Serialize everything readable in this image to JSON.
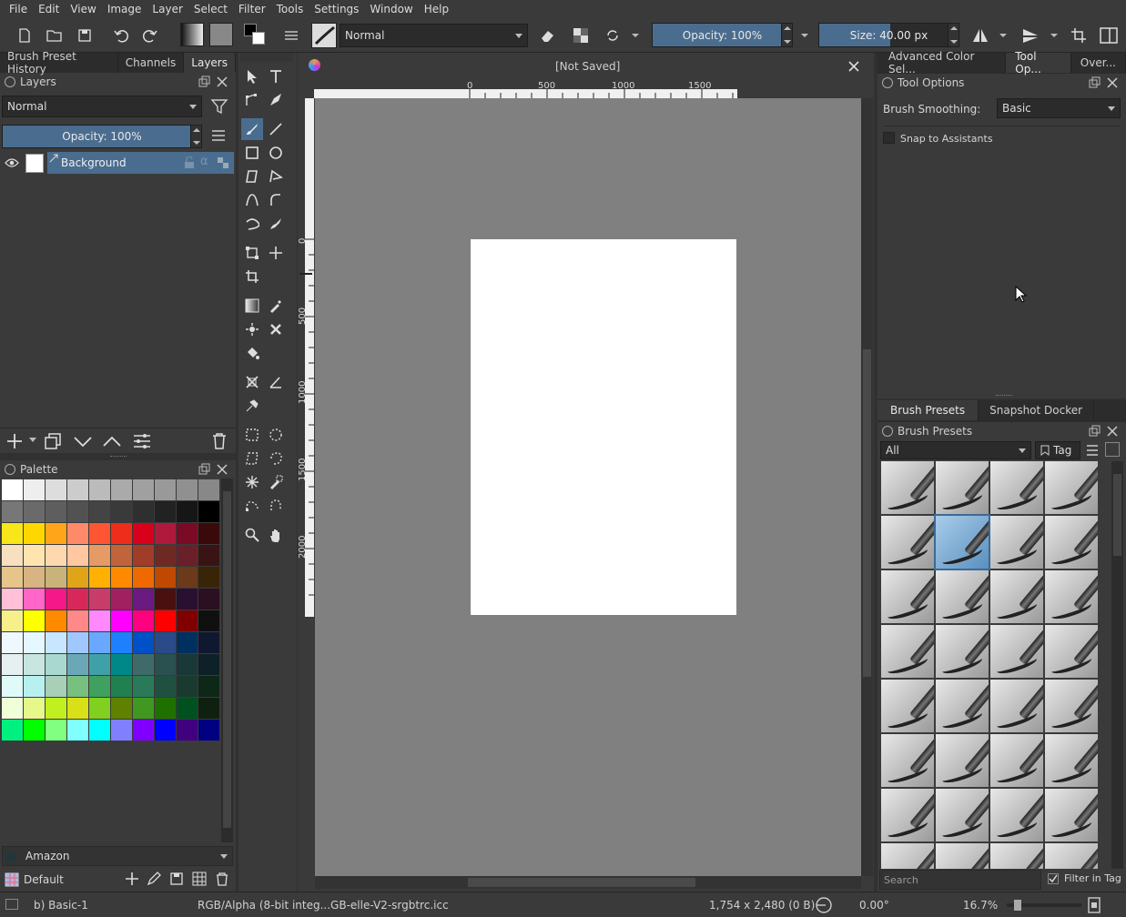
{
  "menu": [
    "File",
    "Edit",
    "View",
    "Image",
    "Layer",
    "Select",
    "Filter",
    "Tools",
    "Settings",
    "Window",
    "Help"
  ],
  "toolbar": {
    "blend_mode": "Normal",
    "opacity_label": "Opacity: 100%",
    "opacity_value": 100,
    "size_label": "Size: 40.00 px",
    "size_fill_fraction": 0.55
  },
  "left_tabs": [
    "Brush Preset History",
    "Channels",
    "Layers"
  ],
  "layers": {
    "title": "Layers",
    "blend_mode": "Normal",
    "opacity_label": "Opacity:  100%",
    "items": [
      {
        "name": "Background"
      }
    ]
  },
  "palette": {
    "title": "Palette",
    "palette_name": "Amazon",
    "set_name": "Default",
    "rows": [
      [
        "#ffffff",
        "#eeeeee",
        "#dddddd",
        "#cccccc",
        "#bbbbbb",
        "#aaaaaa",
        "#a0a0a0",
        "#999999",
        "#909090",
        "#888888"
      ],
      [
        "#777777",
        "#6a6a6a",
        "#5e5e5e",
        "#525252",
        "#444444",
        "#3a3a3a",
        "#2f2f2f",
        "#222222",
        "#161616",
        "#000000"
      ],
      [
        "#f6e61a",
        "#ffd700",
        "#ffa51a",
        "#ff8a6a",
        "#ff5533",
        "#ee2d1a",
        "#d9001b",
        "#b0183c",
        "#7a0a26",
        "#3a0a0a"
      ],
      [
        "#f6e0c0",
        "#ffe4b0",
        "#ffd8b0",
        "#ffc8a0",
        "#e69a66",
        "#c0643c",
        "#a03c28",
        "#6e2a22",
        "#6a2028",
        "#3a1414"
      ],
      [
        "#e6c48a",
        "#d8b482",
        "#c8b478",
        "#e0a418",
        "#ffb000",
        "#ff8a00",
        "#ee6a00",
        "#c04800",
        "#6a3a1a",
        "#3a2408"
      ],
      [
        "#ffc0d8",
        "#ff66c8",
        "#f51888",
        "#d8285a",
        "#c83c6a",
        "#a02060",
        "#6a1a80",
        "#4a1010",
        "#2a1030",
        "#2a1020"
      ],
      [
        "#f6f08a",
        "#ffff00",
        "#ff8a00",
        "#ff8888",
        "#ff88ff",
        "#ff00ff",
        "#ff0080",
        "#ff0000",
        "#800000",
        "#101010"
      ],
      [
        "#f0f8ff",
        "#e6f8ff",
        "#c8e6ff",
        "#a0c8ff",
        "#6aa8ff",
        "#1e80ff",
        "#0050c8",
        "#2a4a88",
        "#003060",
        "#101830"
      ],
      [
        "#e6f0f0",
        "#c8e6e0",
        "#a8d8d0",
        "#6aa8b8",
        "#40a0a8",
        "#008888",
        "#406a6a",
        "#2a5050",
        "#1a3838",
        "#0e2028"
      ],
      [
        "#e0fafa",
        "#b8f0f0",
        "#a8d0b8",
        "#78c080",
        "#40a060",
        "#208050",
        "#2a7a5a",
        "#205040",
        "#1a3a30",
        "#0e2818"
      ],
      [
        "#f0ffd8",
        "#e6f88a",
        "#c0f020",
        "#d8e018",
        "#80d020",
        "#608000",
        "#409820",
        "#207000",
        "#005020",
        "#102010"
      ],
      [
        "#00f080",
        "#00ff00",
        "#80ff80",
        "#80ffff",
        "#00ffff",
        "#8080ff",
        "#8000ff",
        "#0000ff",
        "#400080",
        "#000080"
      ]
    ]
  },
  "canvas_tab": {
    "title": "[Not Saved]"
  },
  "ruler_h": [
    "0",
    "500",
    "1000",
    "1500"
  ],
  "ruler_v": [
    "0",
    "500",
    "1000",
    "1500",
    "2000"
  ],
  "right_tabs": [
    "Advanced Color Sel...",
    "Tool Op...",
    "Over..."
  ],
  "tool_options": {
    "title": "Tool Options",
    "smoothing_label": "Brush Smoothing:",
    "smoothing_value": "Basic",
    "snap_label": "Snap to Assistants"
  },
  "brush_tabs": [
    "Brush Presets",
    "Snapshot Docker"
  ],
  "brush_presets": {
    "title": "Brush Presets",
    "filter": "All",
    "tag_label": "Tag",
    "search_placeholder": "Search",
    "filter_in_tag": "Filter in Tag"
  },
  "status": {
    "brush": "b) Basic-1",
    "color_profile": "RGB/Alpha (8-bit integ...GB-elle-V2-srgbtrc.icc",
    "dimensions": "1,754 x 2,480 (0 B)",
    "rotation": "0.00°",
    "zoom": "16.7%"
  }
}
